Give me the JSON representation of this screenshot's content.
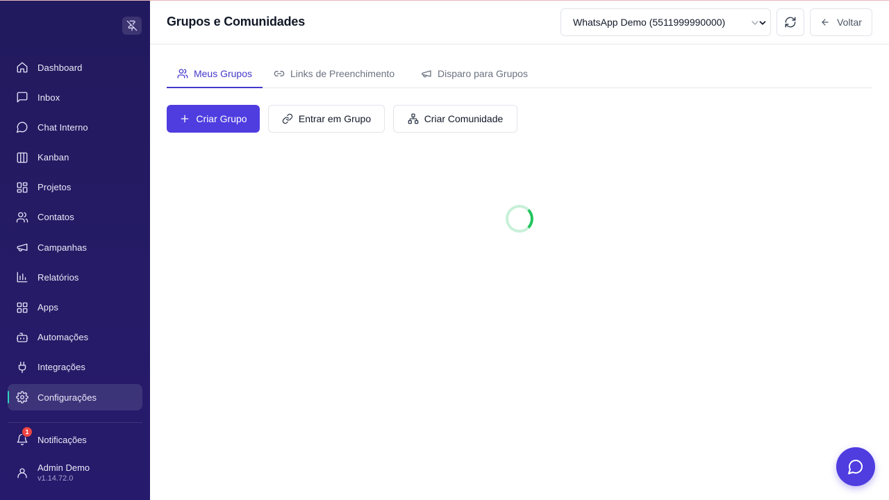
{
  "colors": {
    "sidebar_bg": "#231a61",
    "accent": "#4f3de0",
    "active_indicator": "#2dd4bf",
    "badge": "#ef4444",
    "spinner": "#22c55e"
  },
  "sidebar": {
    "pin_icon": "pin-off-icon",
    "items": [
      {
        "label": "Dashboard",
        "icon": "home-icon"
      },
      {
        "label": "Inbox",
        "icon": "message-square-icon"
      },
      {
        "label": "Chat Interno",
        "icon": "message-circle-icon"
      },
      {
        "label": "Kanban",
        "icon": "columns-icon"
      },
      {
        "label": "Projetos",
        "icon": "layout-dashboard-icon"
      },
      {
        "label": "Contatos",
        "icon": "users-icon"
      },
      {
        "label": "Campanhas",
        "icon": "megaphone-icon"
      },
      {
        "label": "Relatórios",
        "icon": "bar-chart-icon"
      },
      {
        "label": "Apps",
        "icon": "grid-icon"
      },
      {
        "label": "Automações",
        "icon": "bot-icon"
      },
      {
        "label": "Integrações",
        "icon": "plug-icon"
      },
      {
        "label": "Configurações",
        "icon": "settings-icon",
        "active": true
      }
    ],
    "notifications": {
      "label": "Notificações",
      "count": "1"
    },
    "user": {
      "name": "Admin Demo",
      "version": "v1.14.72.0"
    }
  },
  "header": {
    "title": "Grupos e Comunidades",
    "instance_select": "WhatsApp Demo (5511999990000)",
    "back_label": "Voltar"
  },
  "tabs": [
    {
      "label": "Meus Grupos",
      "icon": "users-icon",
      "active": true
    },
    {
      "label": "Links de Preenchimento",
      "icon": "link-icon"
    },
    {
      "label": "Disparo para Grupos",
      "icon": "megaphone-icon"
    }
  ],
  "actions": {
    "create_group": "Criar Grupo",
    "join_group": "Entrar em Grupo",
    "create_community": "Criar Comunidade"
  },
  "loading": true,
  "chat_fab_icon": "message-circle-icon"
}
